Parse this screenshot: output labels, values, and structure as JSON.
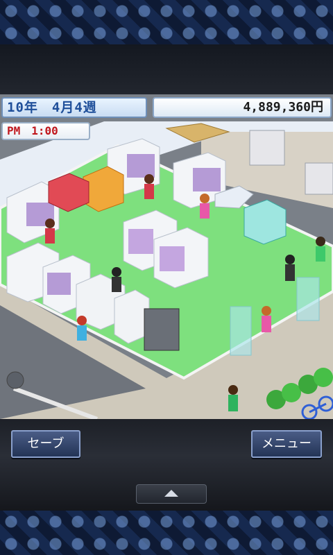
{
  "hud": {
    "date": "10年　4月4週",
    "money": "4,889,360円",
    "time": "PM　1:00"
  },
  "controls": {
    "save_label": "セーブ",
    "menu_label": "メニュー",
    "expand_icon": "triangle-up-icon"
  },
  "scene": {
    "description_icons": [
      "shelf-icon",
      "display-case-icon",
      "character-icon",
      "glass-door-icon",
      "bicycle-icon",
      "tree-icon"
    ]
  },
  "colors": {
    "floor": "#78e07a",
    "sidewalk": "#c9c4b7",
    "road": "#6f747c",
    "wall": "#e8eef6",
    "accent_blue": "#1f4f9a",
    "time_red": "#c0171d"
  }
}
